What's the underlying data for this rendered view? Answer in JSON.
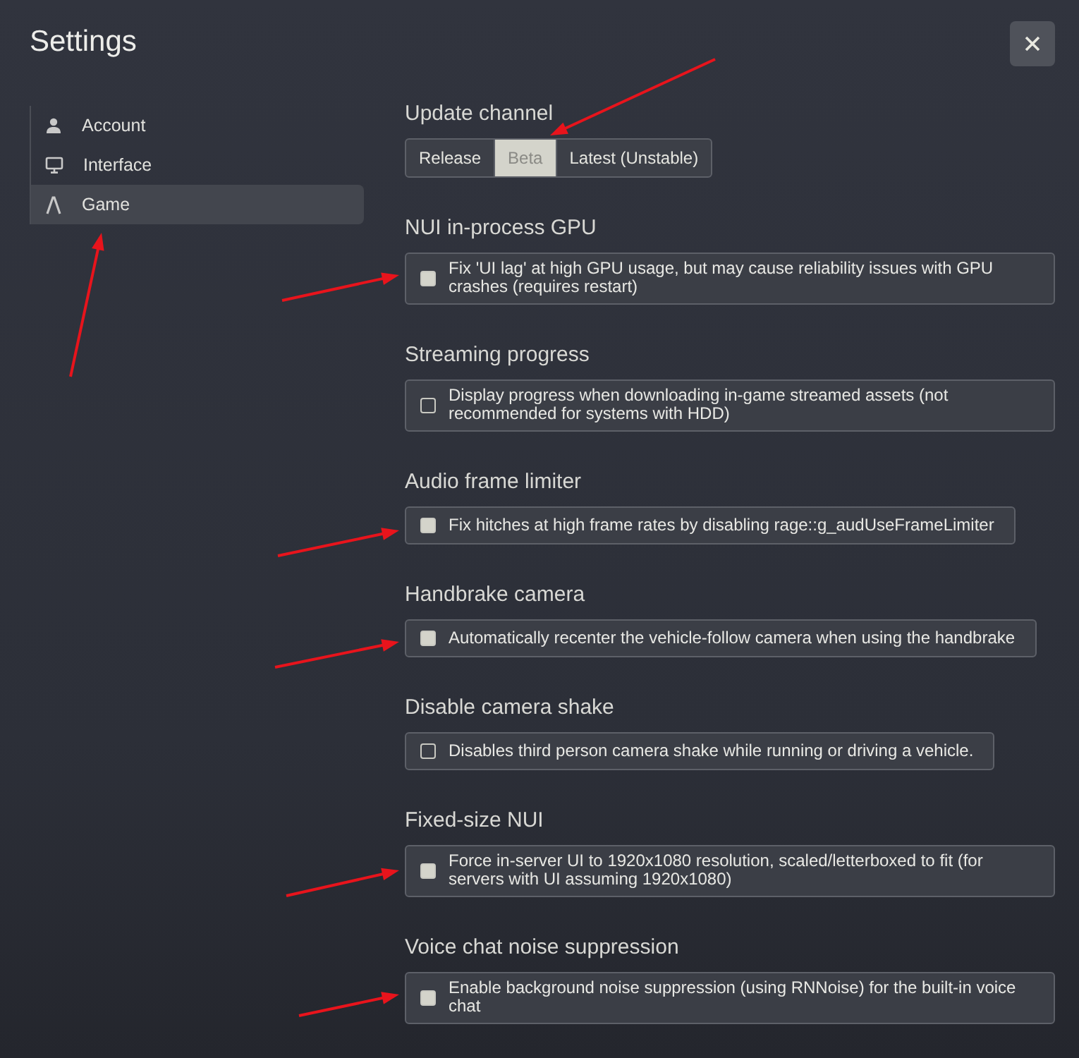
{
  "title": "Settings",
  "sidebar": {
    "items": [
      {
        "label": "Account",
        "selected": false
      },
      {
        "label": "Interface",
        "selected": false
      },
      {
        "label": "Game",
        "selected": true
      }
    ]
  },
  "sections": [
    {
      "kind": "segmented",
      "heading": "Update channel",
      "options": [
        {
          "label": "Release",
          "selected": false
        },
        {
          "label": "Beta",
          "selected": true
        },
        {
          "label": "Latest (Unstable)",
          "selected": false
        }
      ]
    },
    {
      "kind": "checkbox",
      "heading": "NUI in-process GPU",
      "label": "Fix 'UI lag' at high GPU usage, but may cause reliability issues with GPU crashes (requires restart)",
      "checked": true
    },
    {
      "kind": "checkbox",
      "heading": "Streaming progress",
      "label": "Display progress when downloading in-game streamed assets (not recommended for systems with HDD)",
      "checked": false
    },
    {
      "kind": "checkbox",
      "heading": "Audio frame limiter",
      "label": "Fix hitches at high frame rates by disabling rage::g_audUseFrameLimiter",
      "checked": true
    },
    {
      "kind": "checkbox",
      "heading": "Handbrake camera",
      "label": "Automatically recenter the vehicle-follow camera when using the handbrake",
      "checked": true
    },
    {
      "kind": "checkbox",
      "heading": "Disable camera shake",
      "label": "Disables third person camera shake while running or driving a vehicle.",
      "checked": false
    },
    {
      "kind": "checkbox",
      "heading": "Fixed-size NUI",
      "label": "Force in-server UI to 1920x1080 resolution, scaled/letterboxed to fit (for servers with UI assuming 1920x1080)",
      "checked": true
    },
    {
      "kind": "checkbox",
      "heading": "Voice chat noise suppression",
      "label": "Enable background noise suppression (using RNNoise) for the built-in voice chat",
      "checked": true
    }
  ]
}
